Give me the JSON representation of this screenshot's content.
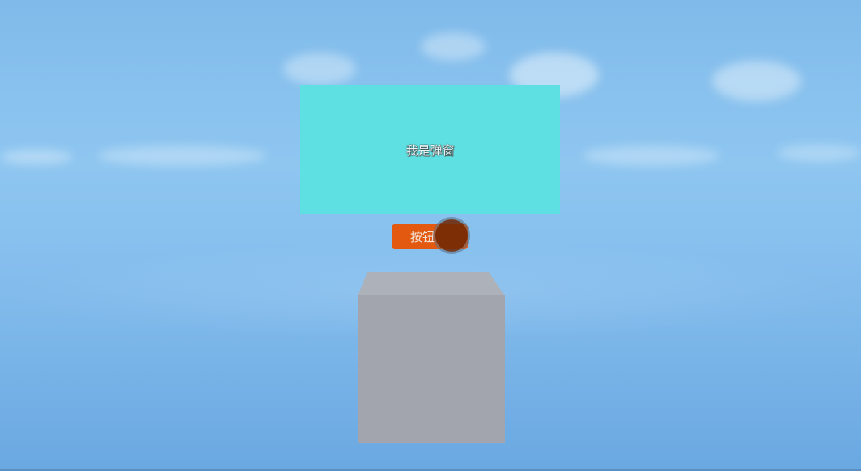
{
  "popup": {
    "text": "我是弹窗",
    "background_color": "#5ee0e2"
  },
  "button": {
    "label": "按钮",
    "background_color": "#e2590f"
  },
  "cube": {
    "color": "#a2a5ae"
  },
  "scene": {
    "sky_color": "#88c1ee"
  }
}
